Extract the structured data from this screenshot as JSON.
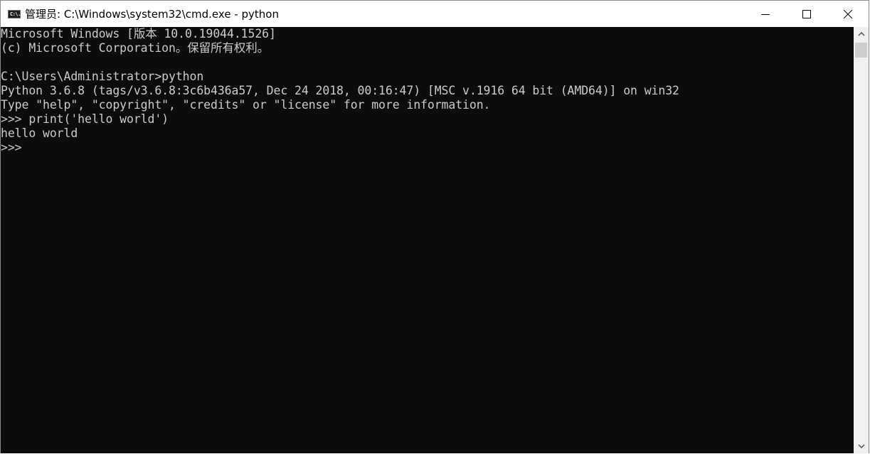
{
  "window": {
    "title": "管理员: C:\\Windows\\system32\\cmd.exe - python",
    "icon": "cmd-icon",
    "icon_glyph": "C:\\.",
    "controls": [
      {
        "name": "minimize",
        "icon": "minimize-icon"
      },
      {
        "name": "maximize",
        "icon": "maximize-icon"
      },
      {
        "name": "close",
        "icon": "close-icon"
      }
    ]
  },
  "console": {
    "lines": [
      "Microsoft Windows [版本 10.0.19044.1526]",
      "(c) Microsoft Corporation。保留所有权利。",
      "",
      "C:\\Users\\Administrator>python",
      "Python 3.6.8 (tags/v3.6.8:3c6b436a57, Dec 24 2018, 00:16:47) [MSC v.1916 64 bit (AMD64)] on win32",
      "Type \"help\", \"copyright\", \"credits\" or \"license\" for more information.",
      ">>> print('hello world')",
      "hello world",
      ">>>"
    ]
  },
  "scrollbar": {
    "up_icon": "chevron-up-icon",
    "down_icon": "chevron-down-icon"
  },
  "colors": {
    "console_bg": "#0c0c0c",
    "console_fg": "#cccccc",
    "titlebar_bg": "#ffffff"
  }
}
